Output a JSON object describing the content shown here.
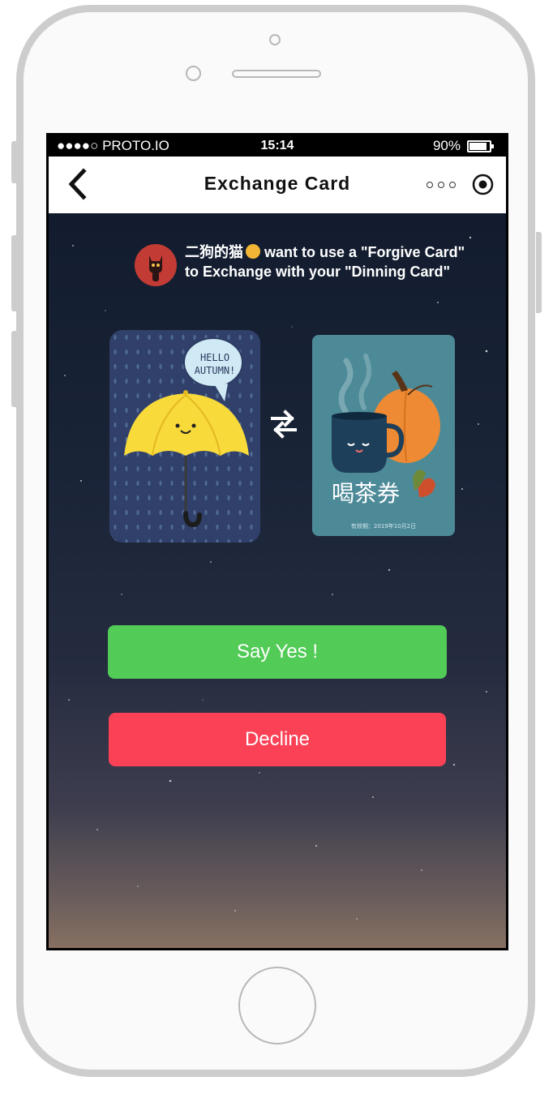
{
  "status_bar": {
    "carrier": "●●●●○ PROTO.IO",
    "time": "15:14",
    "battery": "90%"
  },
  "header": {
    "title": "Exchange Card"
  },
  "request": {
    "sender": "二狗的猫",
    "line1_suffix": " want to use a \"Forgive Card\"",
    "line2": "to Exchange with your \"Dinning Card\""
  },
  "cards": {
    "offered": {
      "bubble_line1": "HELLO",
      "bubble_line2": "AUTUMN!"
    },
    "requested": {
      "title": "喝茶券",
      "validity": "有效期：2019年10月2日"
    }
  },
  "actions": {
    "accept_label": "Say Yes !",
    "decline_label": "Decline"
  },
  "colors": {
    "accept": "#52cb57",
    "decline": "#fb4156",
    "background_top": "#121c2e",
    "background_bottom": "#8a7262"
  }
}
